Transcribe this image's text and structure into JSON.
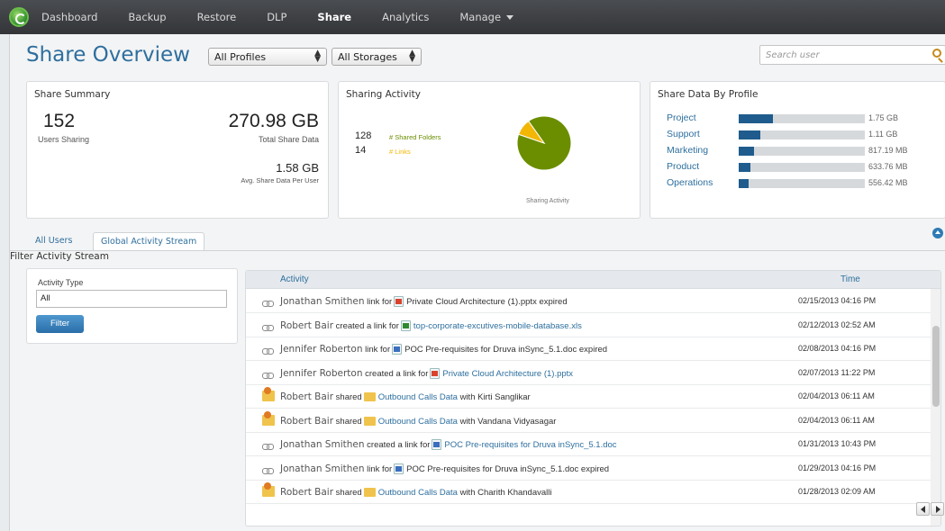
{
  "nav": {
    "items": [
      {
        "label": "Dashboard",
        "active": false
      },
      {
        "label": "Backup",
        "active": false
      },
      {
        "label": "Restore",
        "active": false
      },
      {
        "label": "DLP",
        "active": false
      },
      {
        "label": "Share",
        "active": true
      },
      {
        "label": "Analytics",
        "active": false
      },
      {
        "label": "Manage",
        "active": false,
        "dropdown": true
      }
    ]
  },
  "header": {
    "title": "Share Overview",
    "profile_select": "All Profiles",
    "storage_select": "All Storages",
    "search_placeholder": "Search user"
  },
  "share_summary": {
    "title": "Share Summary",
    "users_sharing": "152",
    "users_sharing_label": "Users Sharing",
    "total_share_data": "270.98 GB",
    "total_share_data_label": "Total Share Data",
    "avg_share": "1.58 GB",
    "avg_share_label": "Avg. Share Data Per User"
  },
  "sharing_activity": {
    "title": "Sharing Activity",
    "shared_folders_count": "128",
    "shared_folders_label": "# Shared Folders",
    "links_count": "14",
    "links_label": "# Links",
    "chart_caption": "Sharing Activity",
    "colors": {
      "folders": "#6b8e00",
      "links": "#f2b705"
    }
  },
  "share_by_profile": {
    "title": "Share Data By Profile",
    "rows": [
      {
        "name": "Project",
        "value": "1.75 GB",
        "fraction": 0.27
      },
      {
        "name": "Support",
        "value": "1.11 GB",
        "fraction": 0.17
      },
      {
        "name": "Marketing",
        "value": "817.19 MB",
        "fraction": 0.12
      },
      {
        "name": "Product",
        "value": "633.76 MB",
        "fraction": 0.09
      },
      {
        "name": "Operations",
        "value": "556.42 MB",
        "fraction": 0.08
      }
    ]
  },
  "tabs": [
    {
      "label": "All Users",
      "active": false
    },
    {
      "label": "Global Activity Stream",
      "active": true
    }
  ],
  "filter": {
    "heading": "Filter Activity Stream",
    "label": "Activity Type",
    "value": "All",
    "button": "Filter"
  },
  "activity_table": {
    "col_activity": "Activity",
    "col_time": "Time",
    "rows": [
      {
        "icon": "link",
        "user": "Jonathan Smithen",
        "action": "link for",
        "ftype": "ppt",
        "file": "Private Cloud Architecture (1).pptx",
        "file_link": false,
        "suffix": "expired",
        "time": "02/15/2013 04:16 PM"
      },
      {
        "icon": "link",
        "user": "Robert Bair",
        "action": "created a link for",
        "ftype": "xls",
        "file": "top-corporate-excutives-mobile-database.xls",
        "file_link": true,
        "suffix": "",
        "time": "02/12/2013 02:52 AM"
      },
      {
        "icon": "link",
        "user": "Jennifer Roberton",
        "action": "link for",
        "ftype": "doc",
        "file": "POC Pre-requisites for Druva inSync_5.1.doc",
        "file_link": false,
        "suffix": "expired",
        "time": "02/08/2013 04:16 PM"
      },
      {
        "icon": "link",
        "user": "Jennifer Roberton",
        "action": "created a link for",
        "ftype": "ppt",
        "file": "Private Cloud Architecture (1).pptx",
        "file_link": true,
        "suffix": "",
        "time": "02/07/2013 11:22 PM"
      },
      {
        "icon": "share",
        "user": "Robert Bair",
        "action": "shared",
        "ftype": "folder",
        "file": "Outbound Calls Data",
        "file_link": true,
        "suffix": "with Kirti Sanglikar",
        "time": "02/04/2013 06:11 AM"
      },
      {
        "icon": "share",
        "user": "Robert Bair",
        "action": "shared",
        "ftype": "folder",
        "file": "Outbound Calls Data",
        "file_link": true,
        "suffix": "with Vandana Vidyasagar",
        "time": "02/04/2013 06:11 AM"
      },
      {
        "icon": "link",
        "user": "Jonathan Smithen",
        "action": "created a link for",
        "ftype": "doc",
        "file": "POC Pre-requisites for Druva inSync_5.1.doc",
        "file_link": true,
        "suffix": "",
        "time": "01/31/2013 10:43 PM"
      },
      {
        "icon": "link",
        "user": "Jonathan Smithen",
        "action": "link for",
        "ftype": "doc",
        "file": "POC Pre-requisites for Druva inSync_5.1.doc",
        "file_link": false,
        "suffix": "expired",
        "time": "01/29/2013 04:16 PM"
      },
      {
        "icon": "share",
        "user": "Robert Bair",
        "action": "shared",
        "ftype": "folder",
        "file": "Outbound Calls Data",
        "file_link": true,
        "suffix": "with Charith Khandavalli",
        "time": "01/28/2013 02:09 AM"
      }
    ]
  },
  "chart_data": {
    "type": "pie",
    "categories": [
      "# Shared Folders",
      "# Links"
    ],
    "values": [
      128,
      14
    ],
    "title": "Sharing Activity"
  }
}
